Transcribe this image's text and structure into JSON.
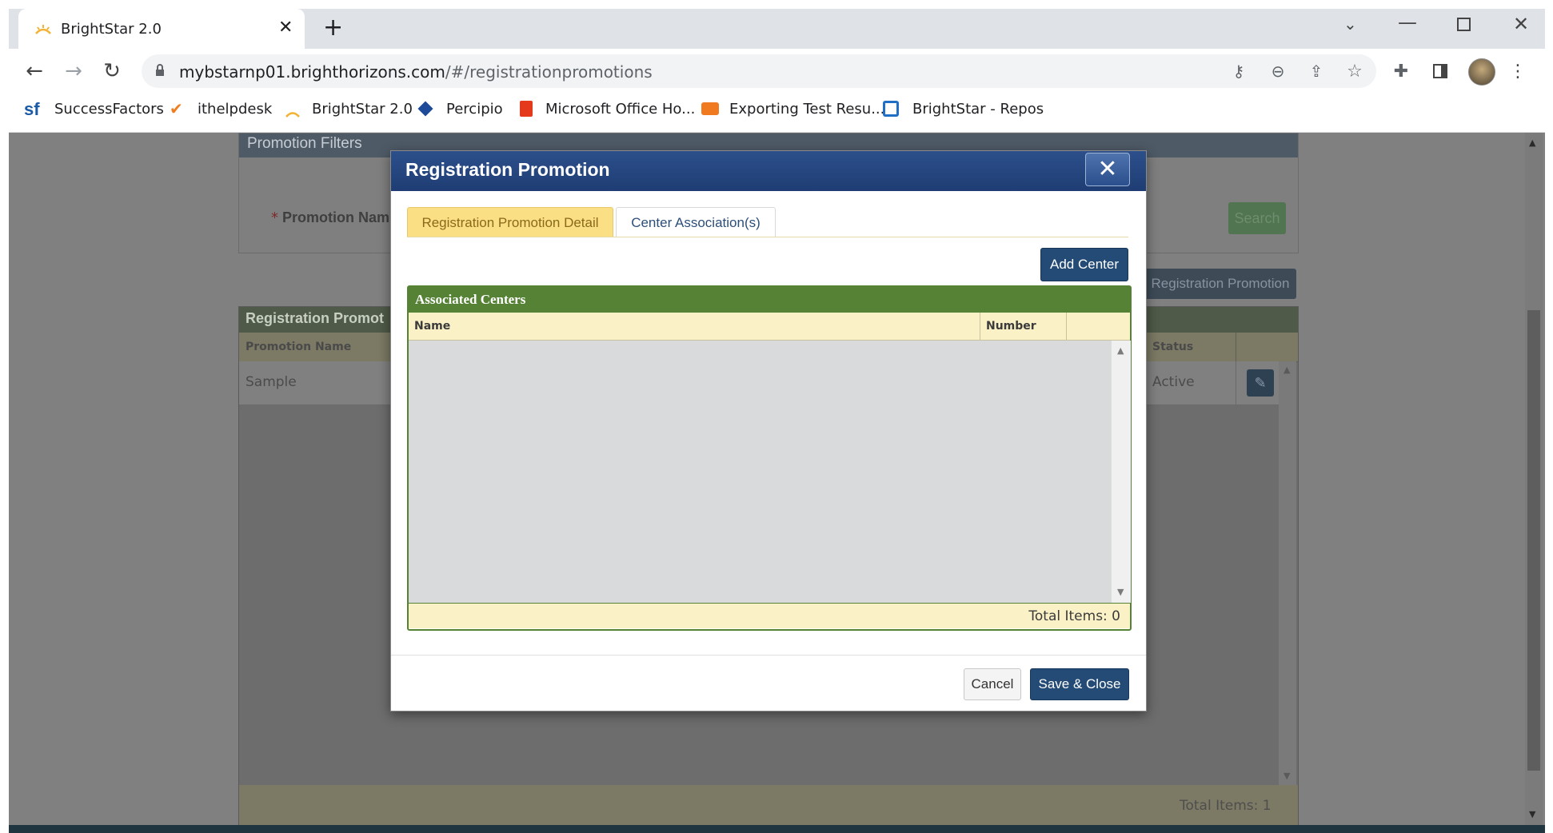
{
  "browser": {
    "tab_title": "BrightStar 2.0",
    "url_host": "mybstarnp01.brighthorizons.com",
    "url_path": "/#/registrationpromotions",
    "bookmarks": [
      "SuccessFactors",
      "ithelpdesk",
      "BrightStar 2.0",
      "Percipio",
      "Microsoft Office Ho...",
      "Exporting Test Resu...",
      "BrightStar - Repos"
    ]
  },
  "background": {
    "filters_title": "Promotion Filters",
    "promotion_name_label": "Promotion Nam",
    "required_mark": "*",
    "search_label": "Search",
    "new_promotion_label": "Registration Promotion",
    "grid_title": "Registration Promot",
    "col_promotion_name": "Promotion Name",
    "col_status": "Status",
    "row_name": "Sample",
    "row_status": "Active",
    "total_items": "Total Items: 1"
  },
  "modal": {
    "title": "Registration Promotion",
    "tabs": [
      "Registration Promotion Detail",
      "Center Association(s)"
    ],
    "add_center_label": "Add Center",
    "grid_title": "Associated Centers",
    "columns": [
      "Name",
      "Number"
    ],
    "total_items": "Total Items: 0",
    "cancel_label": "Cancel",
    "save_close_label": "Save & Close"
  },
  "colors": {
    "modal_header": "#234682",
    "grid_header_green": "#558235",
    "column_header_bg": "#faf1c6",
    "active_tab_bg": "#fbdf85",
    "primary_button": "#234b76"
  }
}
